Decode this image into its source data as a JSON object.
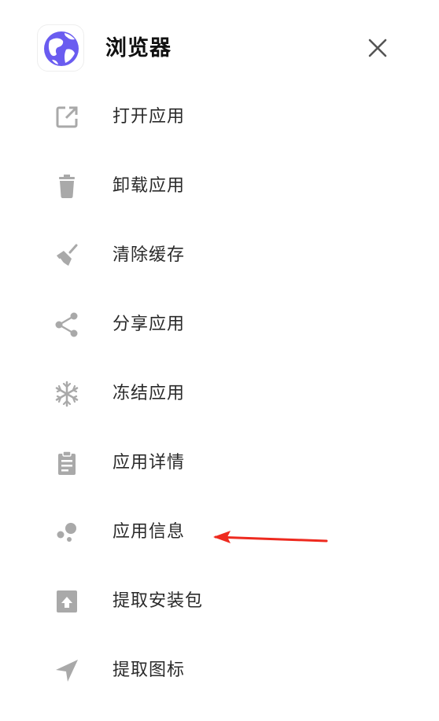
{
  "header": {
    "app_name": "浏览器",
    "app_icon": "globe-icon",
    "close_icon": "close-icon"
  },
  "menu": {
    "items": [
      {
        "label": "打开应用",
        "icon": "open-external-icon"
      },
      {
        "label": "卸载应用",
        "icon": "trash-icon"
      },
      {
        "label": "清除缓存",
        "icon": "broom-icon"
      },
      {
        "label": "分享应用",
        "icon": "share-icon"
      },
      {
        "label": "冻结应用",
        "icon": "snowflake-icon"
      },
      {
        "label": "应用详情",
        "icon": "clipboard-icon"
      },
      {
        "label": "应用信息",
        "icon": "bubbles-icon"
      },
      {
        "label": "提取安装包",
        "icon": "extract-package-icon"
      },
      {
        "label": "提取图标",
        "icon": "navigation-arrow-icon"
      }
    ]
  },
  "colors": {
    "icon_gray": "#a9a9a9",
    "globe_purple": "#6a5cf0",
    "annotation_red": "#ee2a1f"
  }
}
